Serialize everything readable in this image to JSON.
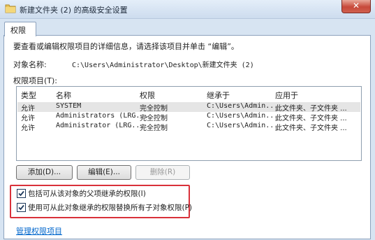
{
  "window": {
    "title": "新建文件夹 (2) 的高级安全设置",
    "close_label": "✕"
  },
  "tabs": [
    {
      "label": "权限"
    }
  ],
  "description": "要查看或编辑权限项目的详细信息，请选择该项目并单击 “编辑”。",
  "object": {
    "label": "对象名称:",
    "value": "C:\\Users\\Administrator\\Desktop\\新建文件夹 (2)"
  },
  "entries": {
    "label": "权限项目(T):",
    "columns": [
      "类型",
      "名称",
      "权限",
      "继承于",
      "应用于"
    ],
    "rows": [
      {
        "type": "允许",
        "name": "SYSTEM",
        "permission": "完全控制",
        "inherited_from": "C:\\Users\\Admin...",
        "applies_to": "此文件夹、子文件夹 ..."
      },
      {
        "type": "允许",
        "name": "Administrators (LRG...",
        "permission": "完全控制",
        "inherited_from": "C:\\Users\\Admin...",
        "applies_to": "此文件夹、子文件夹 ..."
      },
      {
        "type": "允许",
        "name": "Administrator (LRG...",
        "permission": "完全控制",
        "inherited_from": "C:\\Users\\Admin...",
        "applies_to": "此文件夹、子文件夹 ..."
      }
    ]
  },
  "buttons": {
    "add": "添加(D)...",
    "edit": "编辑(E)...",
    "remove": "删除(R)"
  },
  "checkboxes": [
    {
      "label": "包括可从该对象的父项继承的权限(I)",
      "checked": true
    },
    {
      "label": "使用可从此对象继承的权限替换所有子对象权限(P)",
      "checked": true
    }
  ],
  "link": "管理权限项目",
  "colors": {
    "highlight": "#d9313a",
    "link": "#0066cc"
  }
}
